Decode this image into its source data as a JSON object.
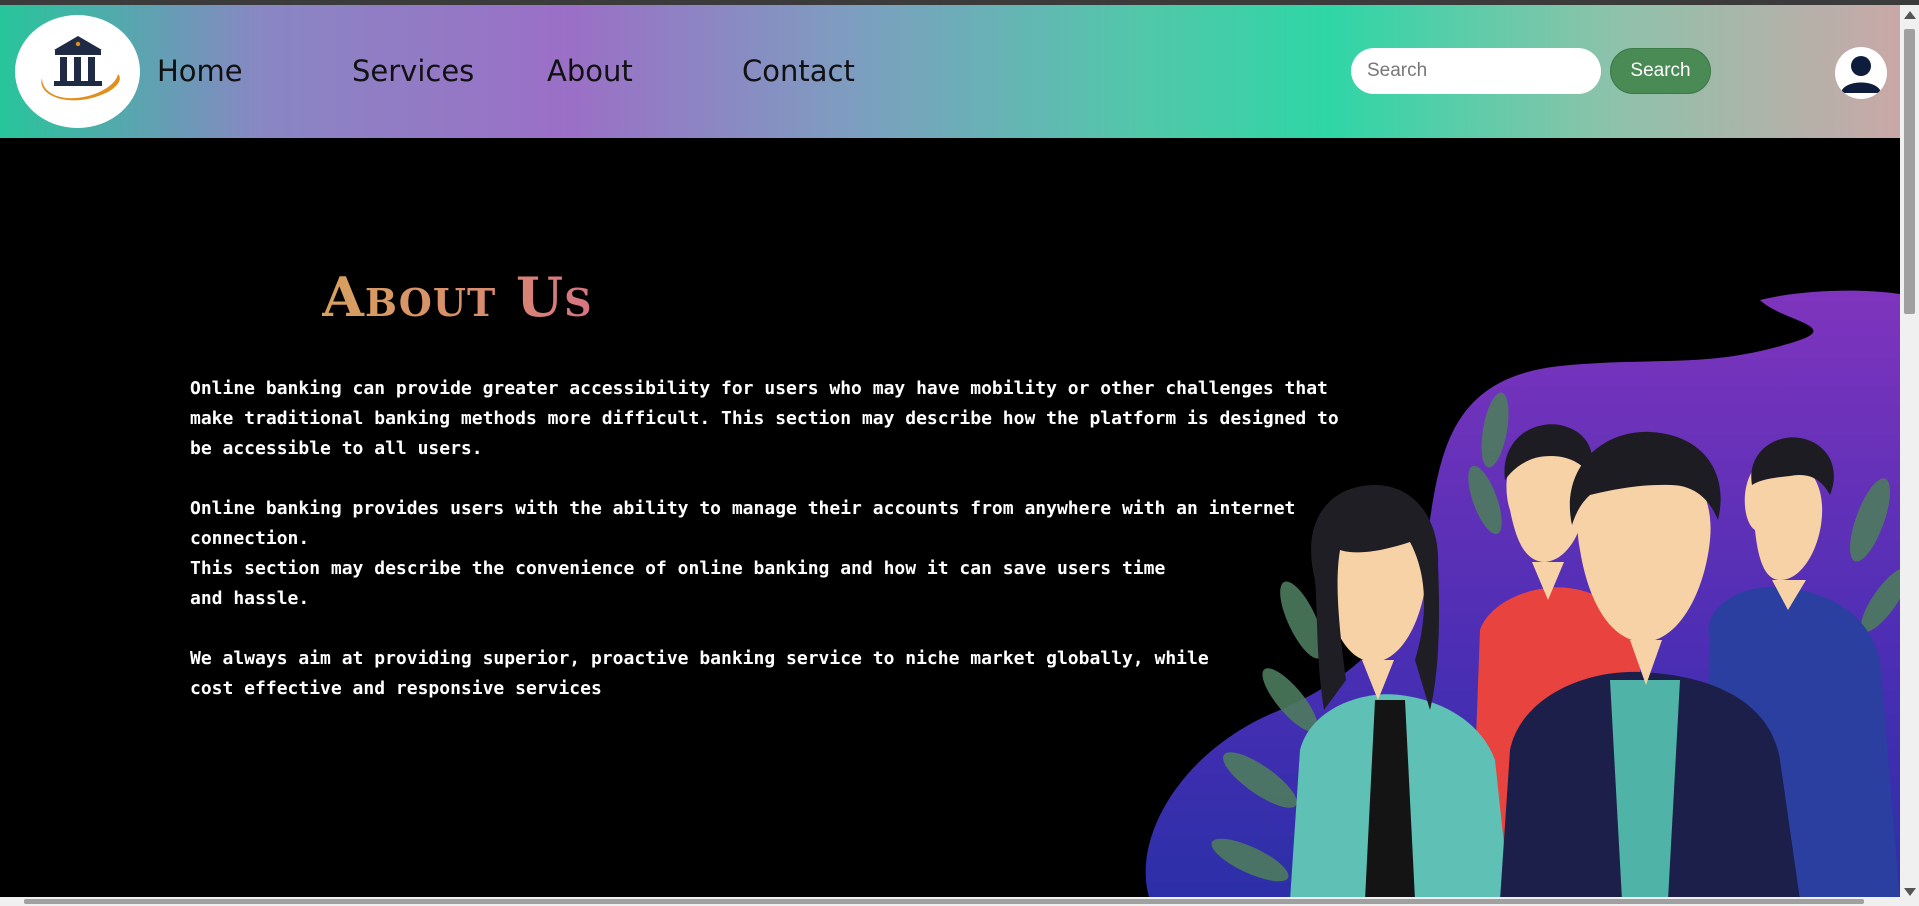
{
  "nav": {
    "links": [
      "Home",
      "Services",
      "About",
      "Contact"
    ],
    "search_placeholder": "Search",
    "search_button": "Search"
  },
  "about": {
    "title": "About Us",
    "paragraphs": [
      "Online banking can provide greater accessibility for users who may have mobility or other challenges that\nmake traditional banking methods more difficult. This section may describe how the platform is designed to\nbe accessible to all users.",
      "Online banking provides users with the ability to manage their accounts from anywhere with an internet\nconnection.\nThis section may describe the convenience of online banking and how it can save users time\nand hassle.",
      "We always aim at providing superior, proactive banking service to niche market globally, while\ncost effective and responsive services"
    ]
  },
  "icons": {
    "logo": "bank-building-icon",
    "avatar": "user-icon",
    "illustration": "team-people-illustration"
  },
  "colors": {
    "page_background": "#000000",
    "search_button": "#4a8a55",
    "title_gradient_start": "#d7a15f",
    "title_gradient_end": "#d67482",
    "blob_purple": "#7a32b8",
    "blob_indigo": "#3a2fb0"
  }
}
